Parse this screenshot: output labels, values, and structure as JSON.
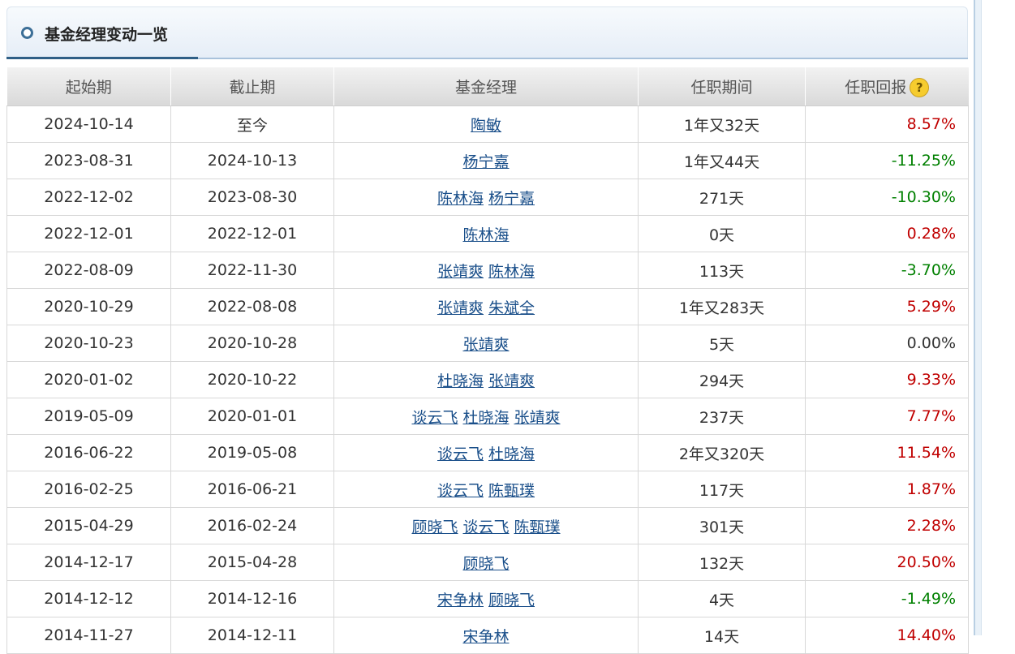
{
  "section_title": "基金经理变动一览",
  "headers": {
    "start": "起始期",
    "end": "截止期",
    "manager": "基金经理",
    "tenure": "任职期间",
    "return": "任职回报",
    "help_icon": "question-mark-icon"
  },
  "colors": {
    "positive": "#c00000",
    "negative": "#008000"
  },
  "rows": [
    {
      "start": "2024-10-14",
      "end": "至今",
      "managers": [
        "陶敏"
      ],
      "tenure": "1年又32天",
      "return": "8.57%"
    },
    {
      "start": "2023-08-31",
      "end": "2024-10-13",
      "managers": [
        "杨宁嘉"
      ],
      "tenure": "1年又44天",
      "return": "-11.25%"
    },
    {
      "start": "2022-12-02",
      "end": "2023-08-30",
      "managers": [
        "陈林海",
        "杨宁嘉"
      ],
      "tenure": "271天",
      "return": "-10.30%"
    },
    {
      "start": "2022-12-01",
      "end": "2022-12-01",
      "managers": [
        "陈林海"
      ],
      "tenure": "0天",
      "return": "0.28%"
    },
    {
      "start": "2022-08-09",
      "end": "2022-11-30",
      "managers": [
        "张靖爽",
        "陈林海"
      ],
      "tenure": "113天",
      "return": "-3.70%"
    },
    {
      "start": "2020-10-29",
      "end": "2022-08-08",
      "managers": [
        "张靖爽",
        "朱斌全"
      ],
      "tenure": "1年又283天",
      "return": "5.29%"
    },
    {
      "start": "2020-10-23",
      "end": "2020-10-28",
      "managers": [
        "张靖爽"
      ],
      "tenure": "5天",
      "return": "0.00%"
    },
    {
      "start": "2020-01-02",
      "end": "2020-10-22",
      "managers": [
        "杜晓海",
        "张靖爽"
      ],
      "tenure": "294天",
      "return": "9.33%"
    },
    {
      "start": "2019-05-09",
      "end": "2020-01-01",
      "managers": [
        "谈云飞",
        "杜晓海",
        "张靖爽"
      ],
      "tenure": "237天",
      "return": "7.77%"
    },
    {
      "start": "2016-06-22",
      "end": "2019-05-08",
      "managers": [
        "谈云飞",
        "杜晓海"
      ],
      "tenure": "2年又320天",
      "return": "11.54%"
    },
    {
      "start": "2016-02-25",
      "end": "2016-06-21",
      "managers": [
        "谈云飞",
        "陈甄璞"
      ],
      "tenure": "117天",
      "return": "1.87%"
    },
    {
      "start": "2015-04-29",
      "end": "2016-02-24",
      "managers": [
        "顾晓飞",
        "谈云飞",
        "陈甄璞"
      ],
      "tenure": "301天",
      "return": "2.28%"
    },
    {
      "start": "2014-12-17",
      "end": "2015-04-28",
      "managers": [
        "顾晓飞"
      ],
      "tenure": "132天",
      "return": "20.50%"
    },
    {
      "start": "2014-12-12",
      "end": "2014-12-16",
      "managers": [
        "宋争林",
        "顾晓飞"
      ],
      "tenure": "4天",
      "return": "-1.49%"
    },
    {
      "start": "2014-11-27",
      "end": "2014-12-11",
      "managers": [
        "宋争林"
      ],
      "tenure": "14天",
      "return": "14.40%"
    }
  ]
}
